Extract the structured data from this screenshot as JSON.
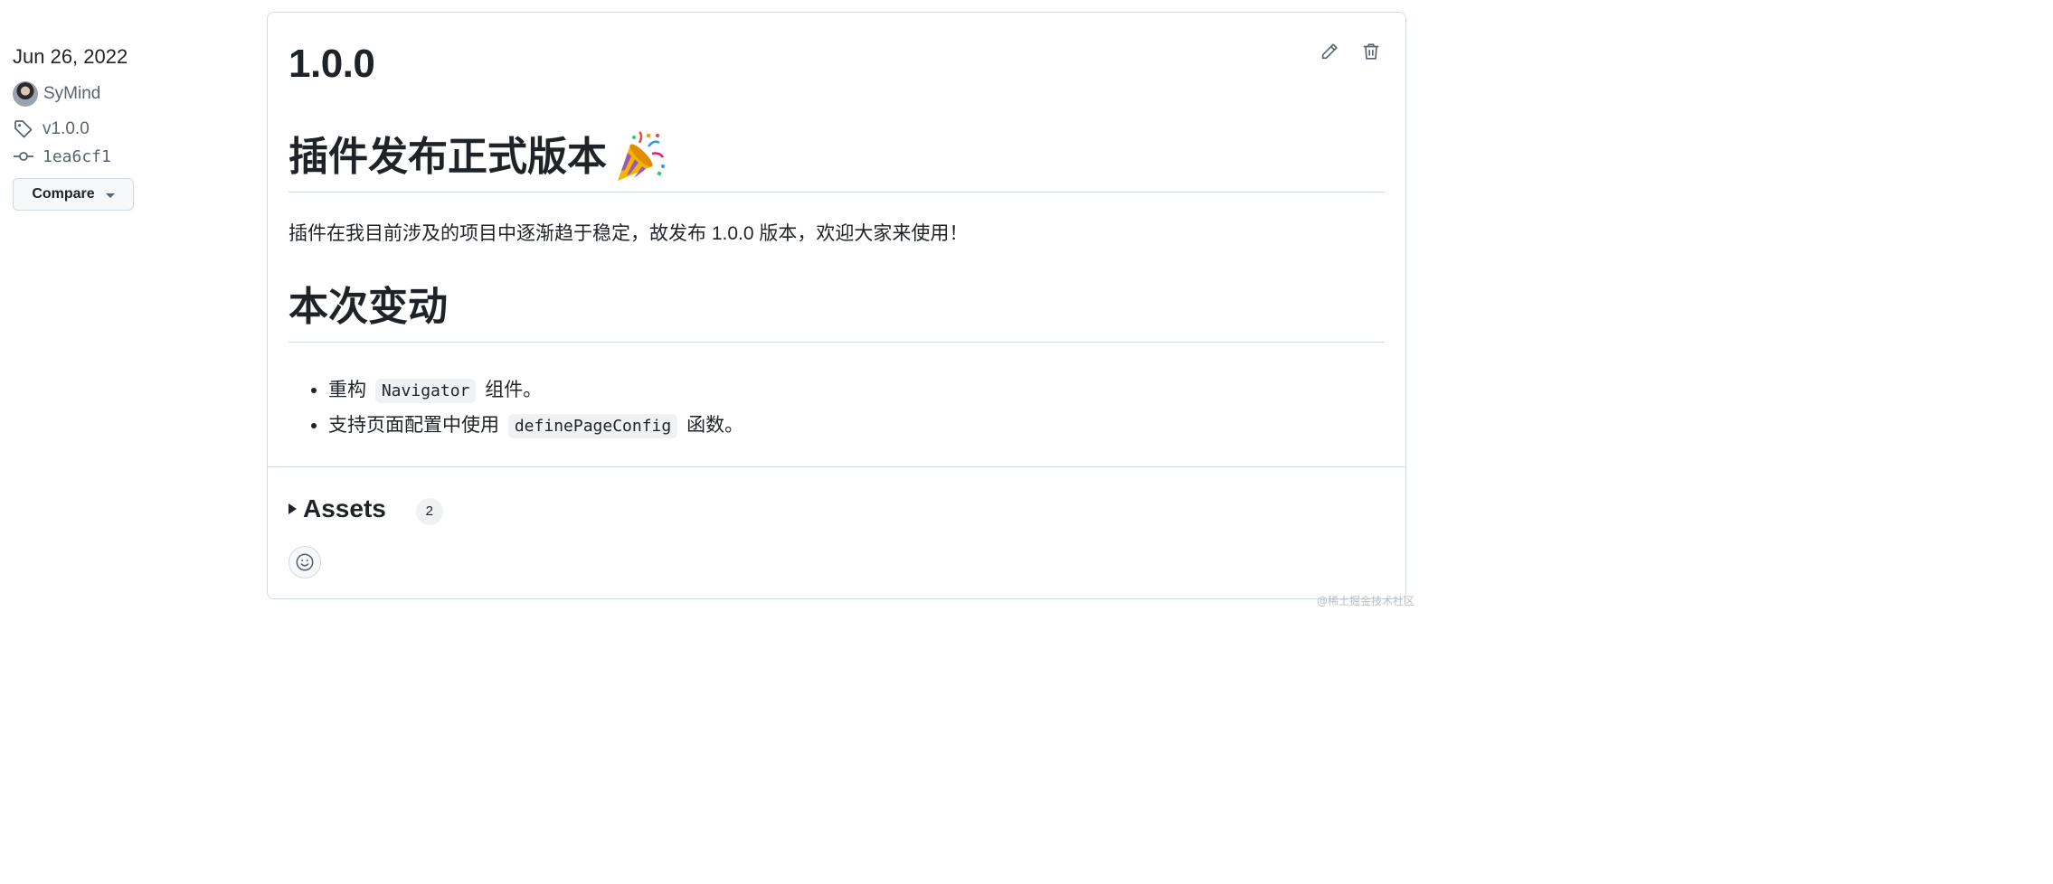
{
  "meta": {
    "date": "Jun 26, 2022",
    "author": "SyMind",
    "tag": "v1.0.0",
    "commit": "1ea6cf1",
    "compare_label": "Compare"
  },
  "release": {
    "title": "1.0.0",
    "heading1": "插件发布正式版本",
    "heading1_emoji": "party-popper-icon",
    "intro": "插件在我目前涉及的项目中逐渐趋于稳定，故发布 1.0.0 版本，欢迎大家来使用！",
    "heading2": "本次变动",
    "changes": [
      {
        "prefix": "重构",
        "code": "Navigator",
        "suffix": "组件。"
      },
      {
        "prefix": "支持页面配置中使用",
        "code": "definePageConfig",
        "suffix": "函数。"
      }
    ]
  },
  "assets": {
    "label": "Assets",
    "count": "2"
  },
  "icons": {
    "edit": "pencil-icon",
    "delete": "trash-icon",
    "tag": "tag-icon",
    "commit": "git-commit-icon",
    "reaction": "smiley-icon"
  },
  "watermark": "@稀土掘金技术社区",
  "colors": {
    "text": "#1f2328",
    "muted": "#59636e",
    "border": "#d1d9e0",
    "code_bg": "#eff1f3"
  }
}
